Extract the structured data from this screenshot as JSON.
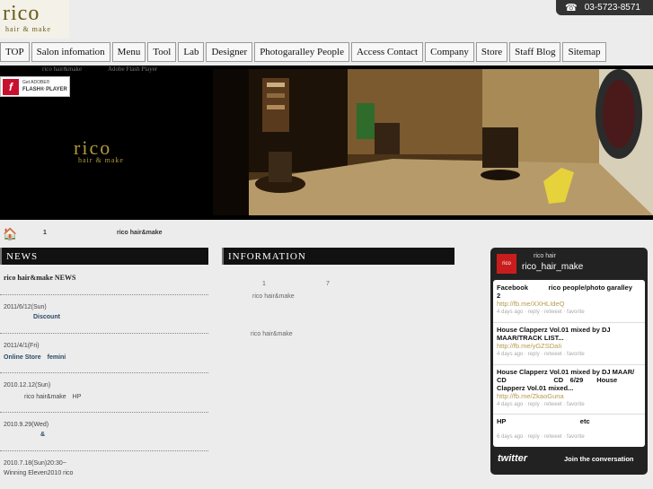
{
  "logo": {
    "main": "rico",
    "sub": "hair & make"
  },
  "header": {
    "phone_icon": "phone-icon",
    "phone": "03-5723-8571"
  },
  "nav": [
    "TOP",
    "Salon infomation",
    "Menu",
    "Tool",
    "Lab",
    "Designer",
    "Photogaralley People",
    "Access Contact",
    "Company",
    "Store",
    "Staff Blog",
    "Sitemap"
  ],
  "subline": {
    "left": "rico hair&make",
    "right": "Adobe Flash Player"
  },
  "flash": {
    "line1": "Get ADOBE®",
    "line2": "FLASH® PLAYER"
  },
  "banner": {
    "brand": "rico",
    "brand_sub": "hair & make"
  },
  "breadcrumb": {
    "home_icon": "home-icon",
    "num": "1",
    "label": "rico hair&make"
  },
  "news": {
    "heading": "NEWS",
    "title": "rico hair&make NEWS",
    "items": [
      {
        "date": "2011/6/12(Sun)",
        "headline": "Discount"
      },
      {
        "date": "2011/4/1(Fri)",
        "headline": "Online Store　femini"
      },
      {
        "date": "2010.12.12(Sun)",
        "headline": "rico hair&make　HP"
      },
      {
        "date": "2010.9.29(Wed)",
        "headline": "&"
      },
      {
        "date": "2010.7.18(Sun)20:30~",
        "headline": "Winning Eleven2010 rico"
      }
    ]
  },
  "info": {
    "heading": "INFORMATION",
    "line1_a": "1",
    "line1_b": "7",
    "line2": "rico hair&make",
    "line3": "rico hair&make"
  },
  "twitter": {
    "avatar_text": "rico",
    "name": "rico hair",
    "handle": "rico_hair_make",
    "tweets": [
      {
        "text": "Facebook　　　rico people/photo garalley　　2",
        "link": "http://fb.me/XXHLIdeQ",
        "meta": "4 days ago · reply · retweet · favorite"
      },
      {
        "text": "House Clapperz Vol.01 mixed by DJ MAAR/TRACK LIST...",
        "link": "http://fb.me/yGZSDaIi",
        "meta": "4 days ago · reply · retweet · favorite"
      },
      {
        "text": "House Clapperz Vol.01 mixed by DJ MAAR/ CD　　　　　　　CD　6/29　　House Clapperz Vol.01 mixed...",
        "link": "http://fb.me/ZkaoGuna",
        "meta": "4 days ago · reply · retweet · favorite"
      },
      {
        "text": "HP　　　　　　　　　　　etc",
        "link": "",
        "meta": "6 days ago · reply · retweet · favorite"
      }
    ],
    "logo": "twitter",
    "join": "Join the conversation"
  }
}
